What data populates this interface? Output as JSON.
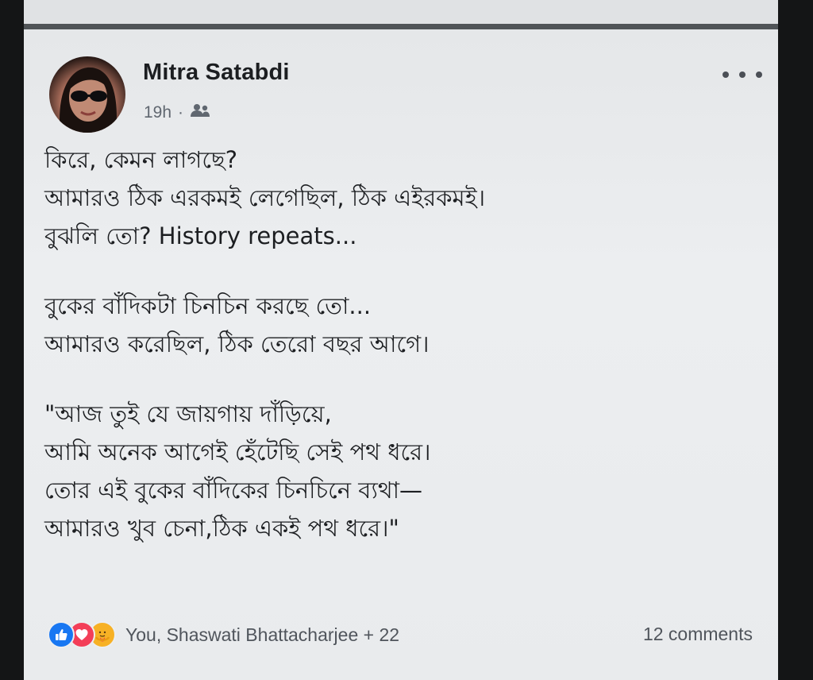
{
  "post": {
    "author": "Mitra Satabdi",
    "time": "19h",
    "separator": "·",
    "audience_icon": "friends-icon",
    "more_icon": "more-horizontal-icon",
    "body_lines": [
      "কিরে, কেমন লাগছে?",
      "আমারও ঠিক এরকমই লেগেছিল, ঠিক এইরকমই।",
      "বুঝলি তো? History repeats...",
      "",
      "বুকের বাঁদিকটা চিনচিন করছে তো...",
      "আমারও করেছিল, ঠিক তেরো বছর আগে।",
      "",
      "\"আজ তুই যে জায়গায় দাঁড়িয়ে,",
      "আমি অনেক আগেই হেঁটেছি সেই পথ ধরে।",
      "তোর এই বুকের বাঁদিকের চিনচিনে ব্যথা—",
      "আমারও খুব চেনা,ঠিক একই পথ ধরে।\""
    ]
  },
  "footer": {
    "reaction_icons": [
      "like-icon",
      "love-icon",
      "care-icon"
    ],
    "reactions_text": "You, Shaswati Bhattacharjee + 22",
    "comments_text": "12 comments"
  },
  "colors": {
    "like": "#1877f2",
    "love": "#f33e58",
    "care": "#f7b125"
  }
}
